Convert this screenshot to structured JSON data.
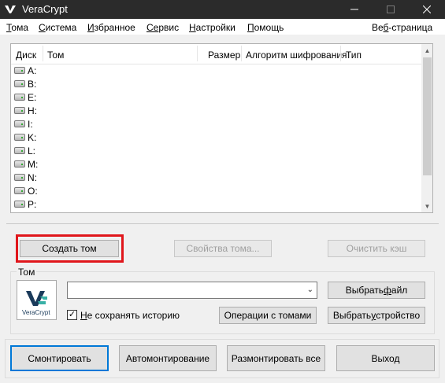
{
  "window": {
    "title": "VeraCrypt"
  },
  "menu": {
    "items": [
      {
        "first": "Т",
        "rest": "ома"
      },
      {
        "first": "С",
        "rest": "истема"
      },
      {
        "first": "И",
        "rest": "збранное"
      },
      {
        "first": "Се",
        "rest": "рвис"
      },
      {
        "first": "Н",
        "rest": "астройки"
      },
      {
        "first": "П",
        "rest": "омощь"
      }
    ],
    "homepage": {
      "first": "Ве",
      "mid": "б",
      "rest": "-страница"
    }
  },
  "volume_list": {
    "columns": [
      "Диск",
      "Том",
      "Размер",
      "Алгоритм шифрования",
      "Тип"
    ],
    "drives": [
      "A:",
      "B:",
      "E:",
      "H:",
      "I:",
      "K:",
      "L:",
      "M:",
      "N:",
      "O:",
      "P:"
    ]
  },
  "buttons": {
    "create_volume": "Создать том",
    "volume_properties": "Свойства тома...",
    "wipe_cache": "Очистить кэш",
    "select_file_pre": "Выбрать ",
    "select_file_u": "ф",
    "select_file_post": "айл",
    "volume_tools": "Операции с томами",
    "select_device_pre": "Выбрать ",
    "select_device_u": "у",
    "select_device_post": "стройство",
    "mount": "Смонтировать",
    "automount": "Автомонтирование",
    "dismount_all": "Размонтировать все",
    "exit": "Выход"
  },
  "volume_group": {
    "label": "Том",
    "path_value": "",
    "never_save_history": {
      "checked": true,
      "first": "Н",
      "rest": "е сохранять историю"
    },
    "logo_text": "VeraCrypt"
  },
  "colors": {
    "titlebar": "#2b2b2b",
    "highlight_box": "#e0161b",
    "primary_border": "#0078d7"
  }
}
